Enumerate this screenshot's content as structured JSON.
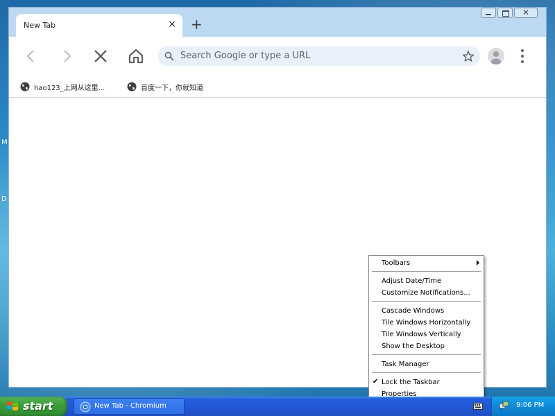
{
  "desktop": {
    "side_letters": [
      "M",
      "D"
    ]
  },
  "browser": {
    "tab_title": "New Tab",
    "tab_close_glyph": "×",
    "new_tab_glyph": "+",
    "window_close_glyph": "✕",
    "omnibox_placeholder": "Search Google or type a URL",
    "bookmarks": [
      {
        "label": "hao123_上网从这里..."
      },
      {
        "label": "百度一下，你就知道"
      }
    ],
    "icons": [
      "back-icon",
      "forward-icon",
      "stop-icon",
      "home-icon",
      "search-icon",
      "star-icon",
      "profile-icon",
      "menu-icon",
      "globe-icon"
    ]
  },
  "context_menu": {
    "items": [
      {
        "label": "Toolbars",
        "submenu": true
      },
      {
        "label": "Adjust Date/Time"
      },
      {
        "label": "Customize Notifications..."
      },
      {
        "label": "Cascade Windows"
      },
      {
        "label": "Tile Windows Horizontally"
      },
      {
        "label": "Tile Windows Vertically"
      },
      {
        "label": "Show the Desktop"
      },
      {
        "label": "Task Manager"
      },
      {
        "label": "Lock the Taskbar",
        "checked": true
      },
      {
        "label": "Properties"
      }
    ],
    "check_glyph": "✔"
  },
  "taskbar": {
    "start_label": "start",
    "task_button_label": "New Tab - Chromium",
    "clock": "9:06 PM"
  },
  "colors": {
    "titlebar": "#bcd9f1",
    "omnibox": "#e8f0fa",
    "taskbar": "#245edb",
    "start": "#3c9c3a",
    "tray": "#0f8ad8"
  }
}
